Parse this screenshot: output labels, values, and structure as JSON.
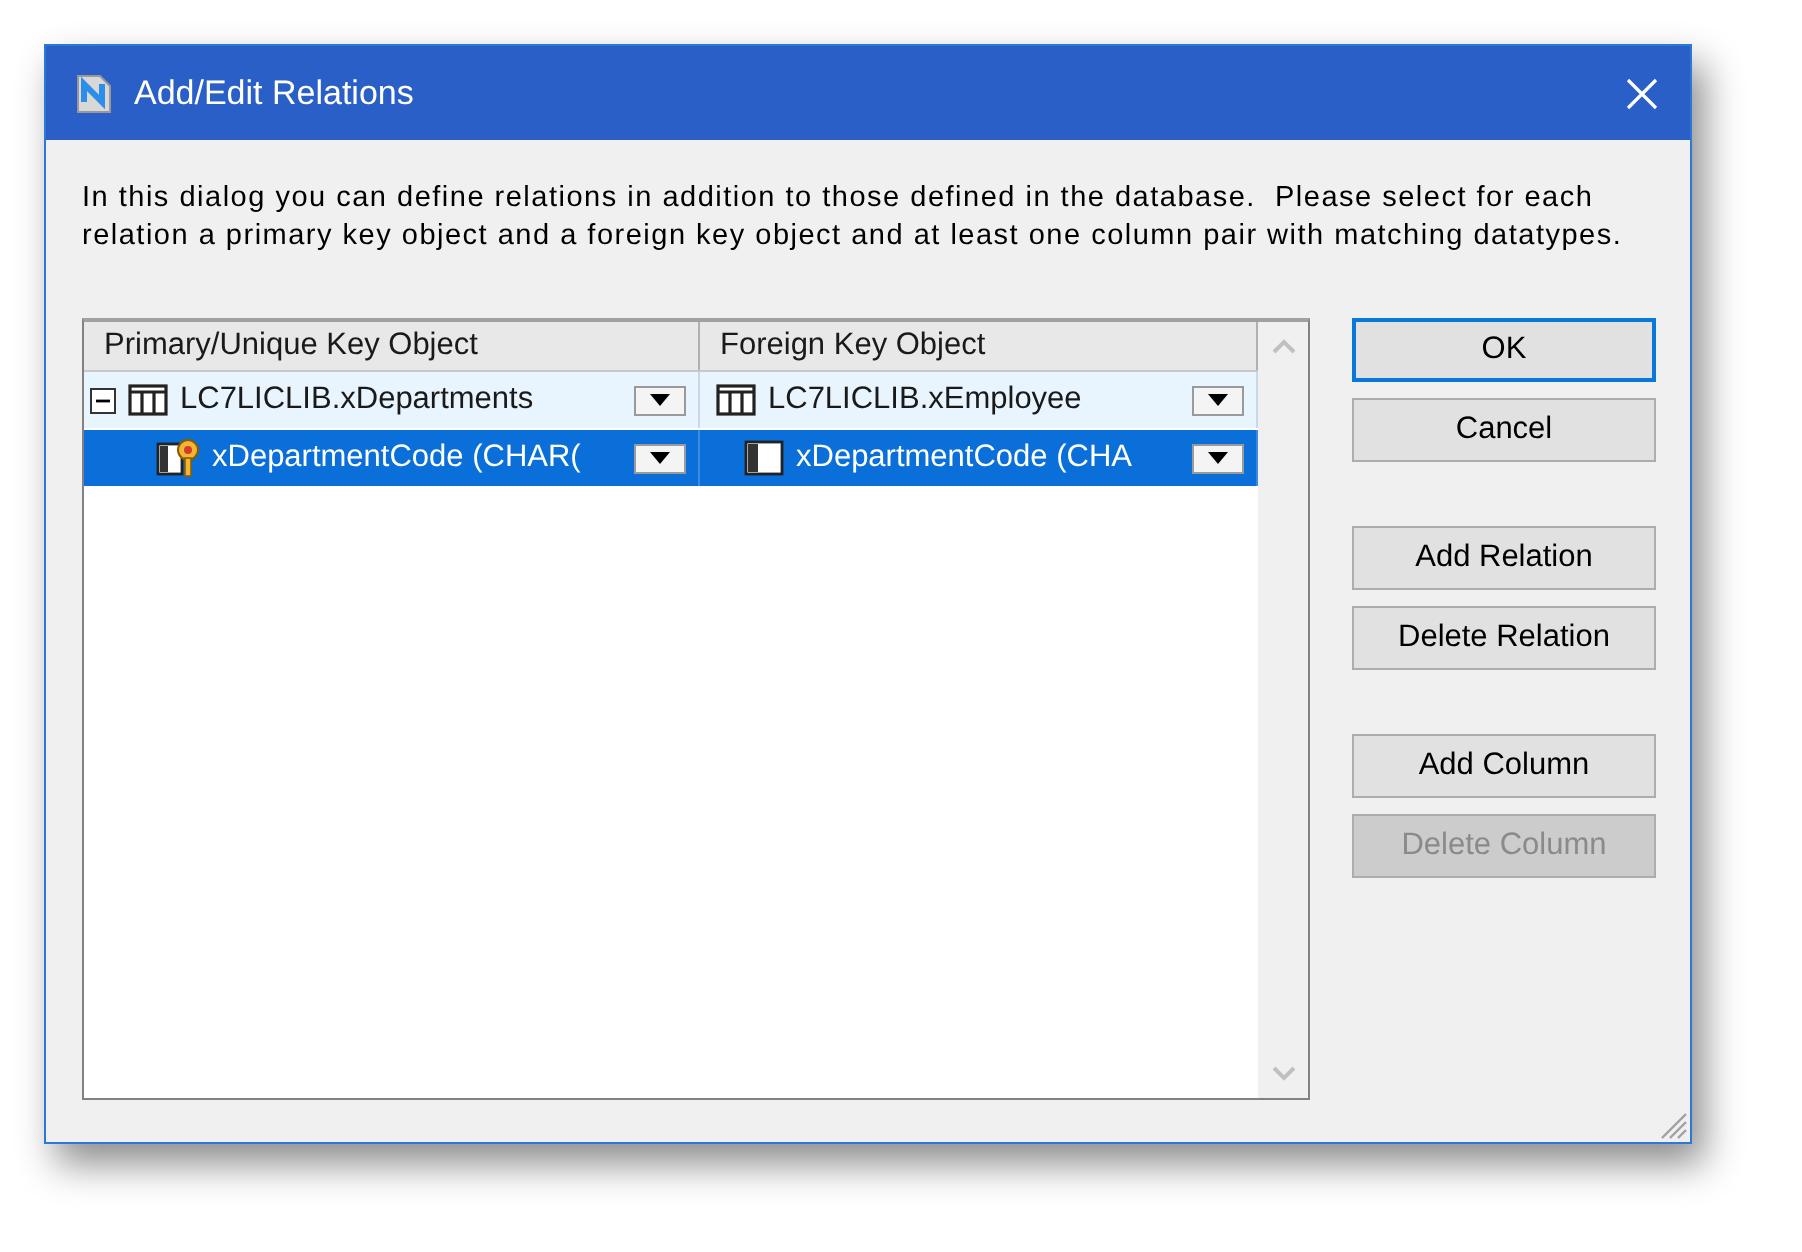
{
  "window": {
    "title": "Add/Edit Relations"
  },
  "description_lines": [
    "In this dialog you can define relations in addition to those defined in the database.  Please select for each",
    "relation a primary key object and a foreign key object and at least one column pair with matching datatypes."
  ],
  "table": {
    "columns": [
      "Primary/Unique Key Object",
      "Foreign Key Object"
    ],
    "rows": [
      {
        "kind": "table",
        "expanded": true,
        "selected": false,
        "cells": [
          "LC7LICLIB.xDepartments",
          "LC7LICLIB.xEmployee"
        ],
        "children": [
          {
            "kind": "column",
            "selected": true,
            "cells": [
              "xDepartmentCode (CHAR(",
              "xDepartmentCode (CHA"
            ]
          }
        ]
      }
    ]
  },
  "button_groups": [
    [
      {
        "label": "OK",
        "default": true,
        "disabled": false
      },
      {
        "label": "Cancel",
        "default": false,
        "disabled": false
      }
    ],
    [
      {
        "label": "Add Relation",
        "default": false,
        "disabled": false
      },
      {
        "label": "Delete Relation",
        "default": false,
        "disabled": false
      }
    ],
    [
      {
        "label": "Add Column",
        "default": false,
        "disabled": false
      },
      {
        "label": "Delete Column",
        "default": false,
        "disabled": true
      }
    ]
  ]
}
